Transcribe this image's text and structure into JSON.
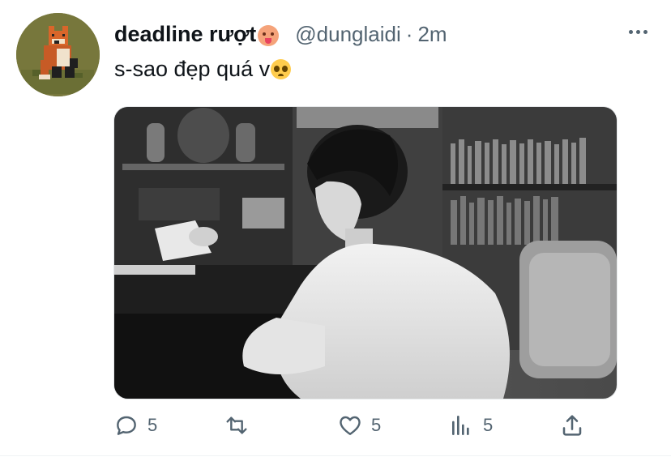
{
  "tweet": {
    "display_name": "deadline rượt",
    "name_emoji": "drooling-face-emoji",
    "handle": "@dunglaidi",
    "separator": "·",
    "time": "2m",
    "text": "s-sao đẹp quá v",
    "text_emoji": "pleading-face-emoji"
  },
  "media": {
    "description_icon": "photo",
    "tone": "grayscale"
  },
  "actions": {
    "reply_count": "5",
    "retweet_count": "",
    "like_count": "5",
    "views_count": "5",
    "icons": [
      "reply-icon",
      "retweet-icon",
      "like-icon",
      "views-icon",
      "share-icon"
    ]
  },
  "colors": {
    "text_primary": "#0f1419",
    "text_secondary": "#536471",
    "border": "#eff3f4",
    "avatar_bg": "#7b7a3e"
  }
}
